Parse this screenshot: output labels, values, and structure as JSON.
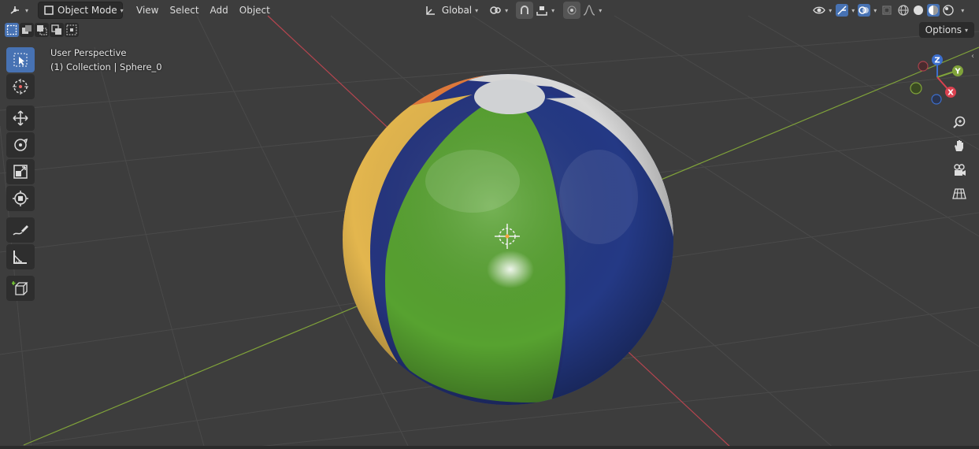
{
  "header": {
    "mode_label": "Object Mode",
    "menus": [
      "View",
      "Select",
      "Add",
      "Object"
    ],
    "orientation_label": "Global"
  },
  "options_label": "Options",
  "viewport_info": {
    "perspective": "User Perspective",
    "collection": "(1) Collection | Sphere_0"
  },
  "gizmo": {
    "z": "Z",
    "y": "Y",
    "x": "X"
  },
  "colors": {
    "accent": "#4772b3",
    "background": "#3d3d3d",
    "grid": "#4a4a4a",
    "x_axis": "#b5454f",
    "y_axis": "#80a33a"
  },
  "icons": {
    "editor_type": "editor-type-icon",
    "select_box": "select-box-icon",
    "cursor": "cursor-icon",
    "move": "move-icon",
    "rotate": "rotate-icon",
    "scale": "scale-icon",
    "transform": "transform-icon",
    "annotate": "annotate-icon",
    "measure": "measure-icon",
    "add_cube": "add-cube-icon",
    "zoom": "zoom-icon",
    "hand": "hand-icon",
    "camera": "camera-icon",
    "grid": "perspective-grid-icon"
  }
}
